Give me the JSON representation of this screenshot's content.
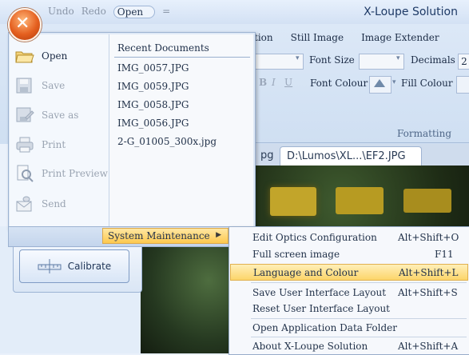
{
  "titlebar": {
    "app_title": "X-Loupe Solution",
    "qat": {
      "undo": "Undo",
      "redo": "Redo",
      "open": "Open",
      "more": "="
    }
  },
  "ribbon": {
    "tabs": [
      "tion",
      "Still Image",
      "Image Extender"
    ],
    "font_size_label": "Font Size",
    "decimals_label": "Decimals",
    "decimals_value": "2",
    "font_colour_label": "Font Colour",
    "fill_colour_label": "Fill Colour",
    "formatting_label": "Formatting"
  },
  "doc_tabs": [
    "pg",
    "D:\\Lumos\\XL...\\EF2.JPG"
  ],
  "app_menu": {
    "commands": [
      {
        "label": "Open",
        "icon": "folder-open-icon",
        "enabled": true
      },
      {
        "label": "Save",
        "icon": "save-icon",
        "enabled": false
      },
      {
        "label": "Save as",
        "icon": "save-as-icon",
        "enabled": false
      },
      {
        "label": "Print",
        "icon": "printer-icon",
        "enabled": false
      },
      {
        "label": "Print Preview",
        "icon": "print-preview-icon",
        "enabled": false
      },
      {
        "label": "Send",
        "icon": "send-icon",
        "enabled": false
      }
    ],
    "recent_title": "Recent Documents",
    "recent": [
      "IMG_0057.JPG",
      "IMG_0059.JPG",
      "IMG_0058.JPG",
      "IMG_0056.JPG",
      "2-G_01005_300x.jpg"
    ],
    "system_maintenance": "System Maintenance"
  },
  "calibrate_label": "Calibrate",
  "submenu": [
    {
      "label": "Edit Optics Configuration",
      "key": "Alt+Shift+O"
    },
    {
      "label": "Full screen image",
      "key": "F11"
    },
    {
      "label": "Language and Colour",
      "key": "Alt+Shift+L",
      "highlighted": true
    },
    {
      "label": "Save User Interface Layout",
      "key": "Alt+Shift+S"
    },
    {
      "label": "Reset User Interface Layout",
      "key": ""
    },
    {
      "label": "Open Application Data Folder",
      "key": ""
    },
    {
      "label": "About X-Loupe Solution",
      "key": "Alt+Shift+A"
    }
  ]
}
